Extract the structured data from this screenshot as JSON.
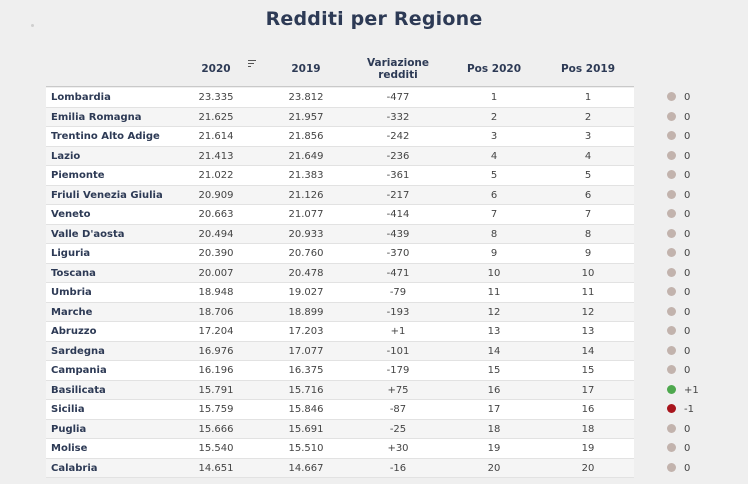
{
  "title": "Redditi per Regione",
  "headers": {
    "col_2020": "2020",
    "col_2019": "2019",
    "variazione": "Variazione redditi",
    "pos_2020": "Pos 2020",
    "pos_2019": "Pos 2019"
  },
  "colors": {
    "neutral": "#c2b3ad",
    "up": "#4ea84e",
    "down": "#a8141c",
    "title": "#2d3a55"
  },
  "rows": [
    {
      "regione": "Lombardia",
      "r2020": "23.335",
      "r2019": "23.812",
      "var": "-477",
      "pos2020": "1",
      "pos2019": "1",
      "change": "0",
      "trend": "neutral"
    },
    {
      "regione": "Emilia Romagna",
      "r2020": "21.625",
      "r2019": "21.957",
      "var": "-332",
      "pos2020": "2",
      "pos2019": "2",
      "change": "0",
      "trend": "neutral"
    },
    {
      "regione": "Trentino Alto Adige",
      "r2020": "21.614",
      "r2019": "21.856",
      "var": "-242",
      "pos2020": "3",
      "pos2019": "3",
      "change": "0",
      "trend": "neutral"
    },
    {
      "regione": "Lazio",
      "r2020": "21.413",
      "r2019": "21.649",
      "var": "-236",
      "pos2020": "4",
      "pos2019": "4",
      "change": "0",
      "trend": "neutral"
    },
    {
      "regione": "Piemonte",
      "r2020": "21.022",
      "r2019": "21.383",
      "var": "-361",
      "pos2020": "5",
      "pos2019": "5",
      "change": "0",
      "trend": "neutral"
    },
    {
      "regione": "Friuli Venezia Giulia",
      "r2020": "20.909",
      "r2019": "21.126",
      "var": "-217",
      "pos2020": "6",
      "pos2019": "6",
      "change": "0",
      "trend": "neutral"
    },
    {
      "regione": "Veneto",
      "r2020": "20.663",
      "r2019": "21.077",
      "var": "-414",
      "pos2020": "7",
      "pos2019": "7",
      "change": "0",
      "trend": "neutral"
    },
    {
      "regione": "Valle D'aosta",
      "r2020": "20.494",
      "r2019": "20.933",
      "var": "-439",
      "pos2020": "8",
      "pos2019": "8",
      "change": "0",
      "trend": "neutral"
    },
    {
      "regione": "Liguria",
      "r2020": "20.390",
      "r2019": "20.760",
      "var": "-370",
      "pos2020": "9",
      "pos2019": "9",
      "change": "0",
      "trend": "neutral"
    },
    {
      "regione": "Toscana",
      "r2020": "20.007",
      "r2019": "20.478",
      "var": "-471",
      "pos2020": "10",
      "pos2019": "10",
      "change": "0",
      "trend": "neutral"
    },
    {
      "regione": "Umbria",
      "r2020": "18.948",
      "r2019": "19.027",
      "var": "-79",
      "pos2020": "11",
      "pos2019": "11",
      "change": "0",
      "trend": "neutral"
    },
    {
      "regione": "Marche",
      "r2020": "18.706",
      "r2019": "18.899",
      "var": "-193",
      "pos2020": "12",
      "pos2019": "12",
      "change": "0",
      "trend": "neutral"
    },
    {
      "regione": "Abruzzo",
      "r2020": "17.204",
      "r2019": "17.203",
      "var": "+1",
      "pos2020": "13",
      "pos2019": "13",
      "change": "0",
      "trend": "neutral"
    },
    {
      "regione": "Sardegna",
      "r2020": "16.976",
      "r2019": "17.077",
      "var": "-101",
      "pos2020": "14",
      "pos2019": "14",
      "change": "0",
      "trend": "neutral"
    },
    {
      "regione": "Campania",
      "r2020": "16.196",
      "r2019": "16.375",
      "var": "-179",
      "pos2020": "15",
      "pos2019": "15",
      "change": "0",
      "trend": "neutral"
    },
    {
      "regione": "Basilicata",
      "r2020": "15.791",
      "r2019": "15.716",
      "var": "+75",
      "pos2020": "16",
      "pos2019": "17",
      "change": "+1",
      "trend": "up"
    },
    {
      "regione": "Sicilia",
      "r2020": "15.759",
      "r2019": "15.846",
      "var": "-87",
      "pos2020": "17",
      "pos2019": "16",
      "change": "-1",
      "trend": "down"
    },
    {
      "regione": "Puglia",
      "r2020": "15.666",
      "r2019": "15.691",
      "var": "-25",
      "pos2020": "18",
      "pos2019": "18",
      "change": "0",
      "trend": "neutral"
    },
    {
      "regione": "Molise",
      "r2020": "15.540",
      "r2019": "15.510",
      "var": "+30",
      "pos2020": "19",
      "pos2019": "19",
      "change": "0",
      "trend": "neutral"
    },
    {
      "regione": "Calabria",
      "r2020": "14.651",
      "r2019": "14.667",
      "var": "-16",
      "pos2020": "20",
      "pos2019": "20",
      "change": "0",
      "trend": "neutral"
    }
  ]
}
